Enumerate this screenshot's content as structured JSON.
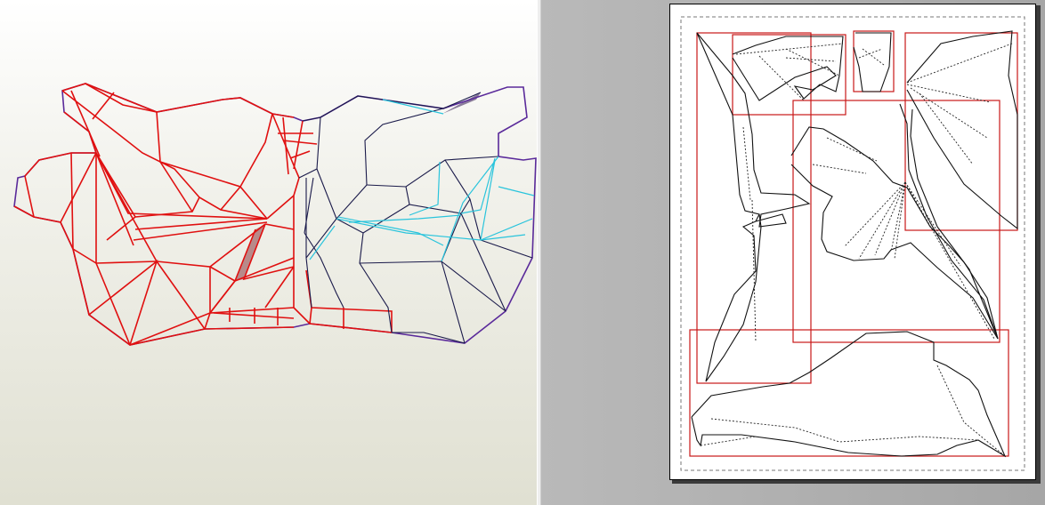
{
  "views": {
    "model_view": "3d-model-view",
    "unfold_view": "2d-unfold-view"
  },
  "colors": {
    "mountain_fold": "#e01010",
    "valley_fold": "#29c4dc",
    "outline": "#5a2a9a",
    "piece_outline": "#111111",
    "bounding_box": "#c81818",
    "selected_face": "#b88888",
    "workspace_bg": "#aaaaaa",
    "paper": "#ffffff"
  }
}
